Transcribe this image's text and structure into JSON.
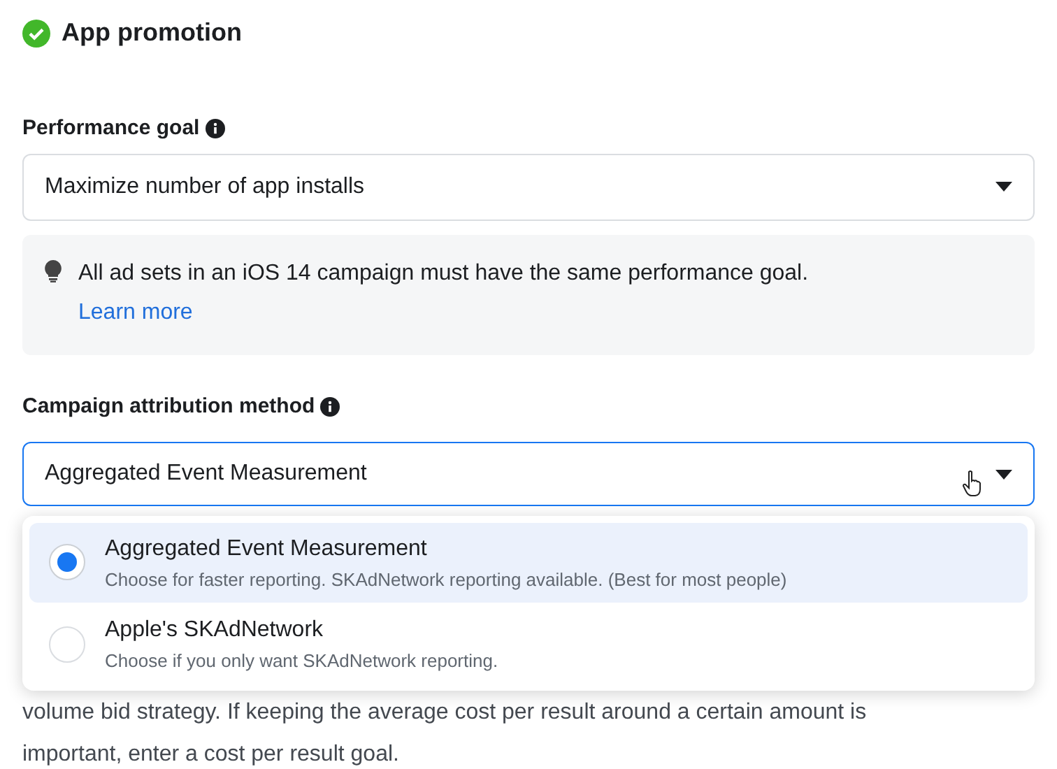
{
  "header": {
    "title": "App promotion"
  },
  "performance_goal": {
    "label": "Performance goal",
    "value": "Maximize number of app installs"
  },
  "notice": {
    "text": "All ad sets in an iOS 14 campaign must have the same performance goal.",
    "link": "Learn more"
  },
  "attribution": {
    "label": "Campaign attribution method",
    "value": "Aggregated Event Measurement",
    "expanded": true,
    "options": [
      {
        "title": "Aggregated Event Measurement",
        "description": "Choose for faster reporting. SKAdNetwork reporting available. (Best for most people)",
        "selected": true
      },
      {
        "title": "Apple's SKAdNetwork",
        "description": "Choose if you only want SKAdNetwork reporting.",
        "selected": false
      }
    ]
  },
  "paragraph": {
    "lines": [
      "volume bid strategy. If keeping the average cost per result around a certain amount is",
      "important, enter a cost per result goal."
    ]
  }
}
